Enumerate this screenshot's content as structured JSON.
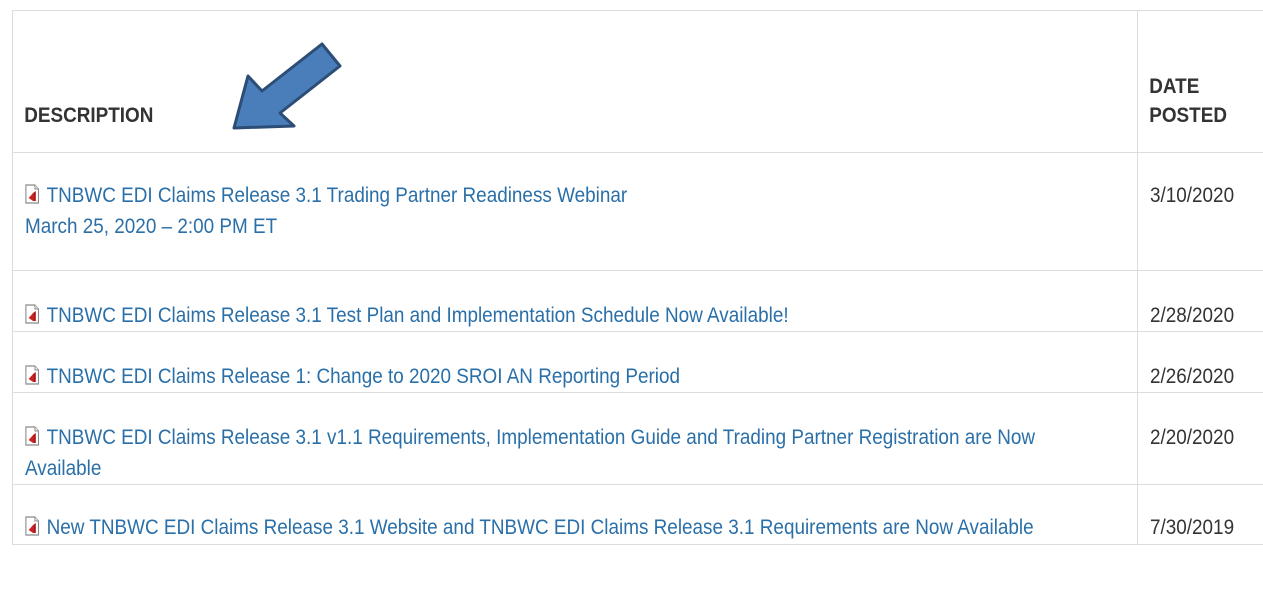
{
  "table": {
    "headers": {
      "description": "DESCRIPTION",
      "date_line1": "DATE",
      "date_line2": "POSTED"
    },
    "rows": [
      {
        "title": "TNBWC EDI Claims Release 3.1 Trading Partner Readiness Webinar",
        "subtitle": "March 25, 2020 – 2:00 PM ET",
        "date": "3/10/2020"
      },
      {
        "title": "TNBWC EDI Claims Release 3.1 Test Plan and Implementation Schedule Now Available!",
        "date": "2/28/2020"
      },
      {
        "title": "TNBWC EDI Claims Release 1: Change to 2020 SROI AN Reporting Period",
        "date": "2/26/2020"
      },
      {
        "title": "TNBWC EDI Claims Release 3.1 v1.1 Requirements, Implementation Guide and Trading Partner Registration are Now Available",
        "date": "2/20/2020"
      },
      {
        "title": "New TNBWC EDI Claims Release 3.1 Website and TNBWC EDI Claims Release 3.1 Requirements are Now Available",
        "date": "7/30/2019"
      }
    ]
  },
  "icons": {
    "document": "pdf-file-icon",
    "annotation": "arrow-annotation-icon"
  },
  "colors": {
    "link": "#2a6fa8",
    "arrow_fill": "#4a7ebb",
    "arrow_stroke": "#2c4d75"
  }
}
